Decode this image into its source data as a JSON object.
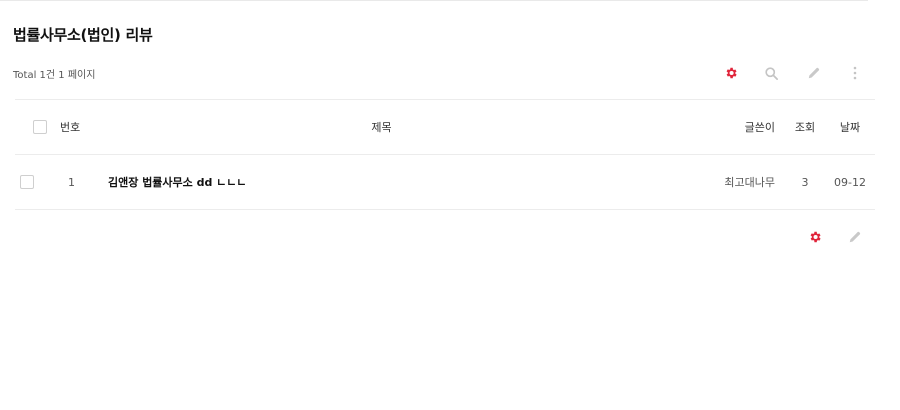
{
  "board": {
    "title": "법률사무소(법인) 리뷰",
    "total_text": "Total 1건 1 페이지"
  },
  "toolbar": {
    "icons": [
      "gear-icon",
      "search-icon",
      "pencil-icon",
      "more-vertical-icon"
    ],
    "gear_color": "#e0243a",
    "muted_color": "#c9c9c9"
  },
  "table": {
    "headers": {
      "num": "번호",
      "title": "제목",
      "writer": "글쓴이",
      "hit": "조회",
      "date": "날짜"
    },
    "rows": [
      {
        "num": "1",
        "title": "김앤장 법률사무소 dd ㄴㄴㄴ",
        "writer": "최고대나무",
        "hit": "3",
        "date": "09-12"
      }
    ]
  },
  "bottom_toolbar": {
    "icons": [
      "gear-icon",
      "pencil-icon"
    ]
  }
}
